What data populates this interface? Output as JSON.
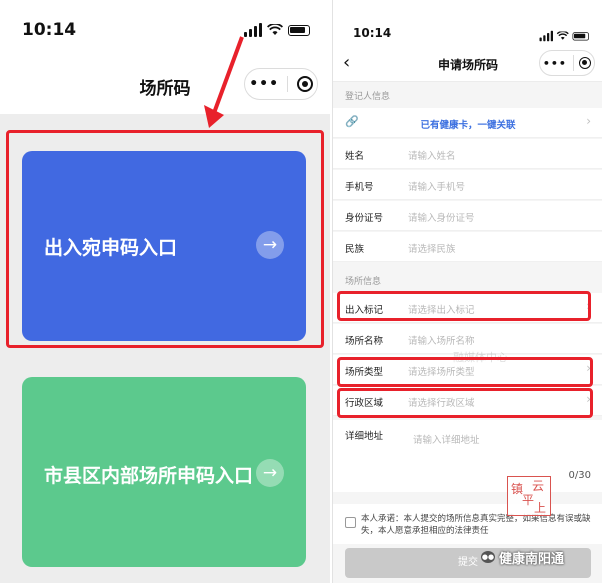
{
  "left_phone": {
    "time": "10:14",
    "title": "场所码",
    "capsule": {
      "menu_icon": "more-dots-icon",
      "close_icon": "target-icon"
    },
    "cards": [
      {
        "label": "出入宛申码入口",
        "color": "#4169e1",
        "arrow_icon": "arrow-right-icon"
      },
      {
        "label": "市县区内部场所申码入口",
        "color": "#5cc98d",
        "arrow_icon": "arrow-right-icon"
      }
    ],
    "annotation_color": "#e8212b"
  },
  "right_phone": {
    "time": "10:14",
    "title": "申请场所码",
    "back_icon": "chevron-left-icon",
    "sections": {
      "registrant": "登记人信息",
      "place": "场所信息"
    },
    "health_card_link": "已有健康卡，一键关联",
    "fields": [
      {
        "label": "姓名",
        "placeholder": "请输入姓名"
      },
      {
        "label": "手机号",
        "placeholder": "请输入手机号"
      },
      {
        "label": "身份证号",
        "placeholder": "请输入身份证号"
      },
      {
        "label": "民族",
        "placeholder": "请选择民族"
      }
    ],
    "place_fields": [
      {
        "label": "出入标记",
        "placeholder": "请选择出入标记"
      },
      {
        "label": "场所名称",
        "placeholder": "请输入场所名称"
      },
      {
        "label": "场所类型",
        "placeholder": "请选择场所类型"
      },
      {
        "label": "行政区域",
        "placeholder": "请选择行政区域"
      }
    ],
    "address": {
      "label": "详细地址",
      "placeholder": "请输入详细地址",
      "count": "0/30"
    },
    "agreement": "本人承诺：本人提交的场所信息真实完整，如果信息有误或缺失，本人愿意承担相应的法律责任",
    "submit": "提交",
    "watermark": {
      "stamp_chars": [
        "镇",
        "云",
        "平",
        "上"
      ],
      "mid_text": "融媒体中心",
      "account": "健康南阳通"
    }
  }
}
